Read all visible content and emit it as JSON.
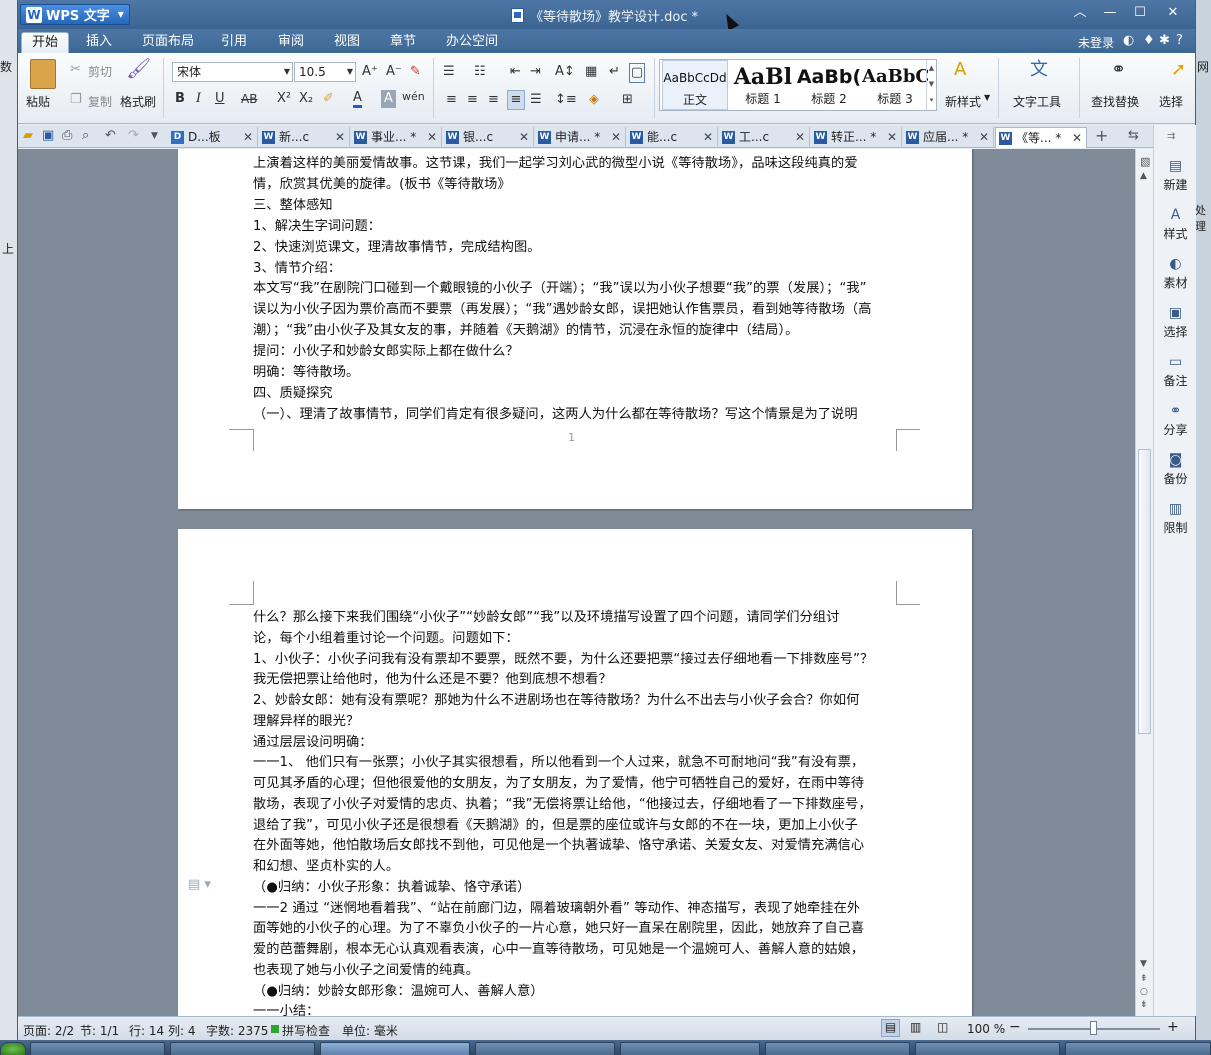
{
  "titlebar": {
    "app_name": "WPS 文字",
    "document_title": "《等待散场》教学设计.doc *",
    "minimize": "—",
    "maximize": "☐",
    "close": "✕",
    "ribbon_toggle": "︿"
  },
  "menu": {
    "tabs": [
      "开始",
      "插入",
      "页面布局",
      "引用",
      "审阅",
      "视图",
      "章节",
      "办公空间"
    ],
    "active_tab": "开始",
    "login": "未登录",
    "help": "?"
  },
  "ribbon": {
    "clipboard": {
      "paste": "粘贴",
      "cut": "剪切",
      "copy": "复制",
      "format_painter": "格式刷"
    },
    "font": {
      "font_name": "宋体",
      "font_size": "10.5"
    },
    "styles": [
      {
        "sample": "AaBbCcDd",
        "name": "正文"
      },
      {
        "sample": "AaBl",
        "name": "标题 1"
      },
      {
        "sample": "AaBb(",
        "name": "标题 2"
      },
      {
        "sample": "AaBbC",
        "name": "标题 3"
      }
    ],
    "new_style": "新样式",
    "text_tools": "文字工具",
    "find_replace": "查找替换",
    "select": "选择"
  },
  "doc_tabs": [
    {
      "label": "D...板",
      "icon": "D"
    },
    {
      "label": "新...c",
      "icon": "W"
    },
    {
      "label": "事业... *",
      "icon": "W"
    },
    {
      "label": "银...c",
      "icon": "W"
    },
    {
      "label": "申请... *",
      "icon": "W"
    },
    {
      "label": "能...c",
      "icon": "W"
    },
    {
      "label": "工...c",
      "icon": "W"
    },
    {
      "label": "转正... *",
      "icon": "W"
    },
    {
      "label": "应届... *",
      "icon": "W"
    },
    {
      "label": "《等... *",
      "icon": "W"
    }
  ],
  "page1": {
    "lines": [
      "上演着这样的美丽爱情故事。这节课，我们一起学习刘心武的微型小说《等待散场》，品味这段纯真的爱",
      "情，欣赏其优美的旋律。(板书《等待散场》",
      "三、整体感知",
      "1、解决生字词问题：",
      "2、快速浏览课文，理清故事情节，完成结构图。",
      "3、情节介绍：",
      "      本文写“我”在剧院门口碰到一个戴眼镜的小伙子（开端）；“我”误以为小伙子想要“我”的票（发展）；“我”",
      "误以为小伙子因为票价高而不要票（再发展）；“我”遇妙龄女郎，误把她认作售票员，看到她等待散场（高",
      "潮）；“我”由小伙子及其女友的事，并随着《天鹅湖》的情节，沉浸在永恒的旋律中（结局）。",
      "提问：小伙子和妙龄女郎实际上都在做什么？",
      "明确：等待散场。",
      "四、质疑探究",
      "（一）、理清了故事情节，同学们肯定有很多疑问，这两人为什么都在等待散场？写这个情景是为了说明"
    ],
    "page_number": "1"
  },
  "page2": {
    "lines": [
      "什么？那么接下来我们围绕“小伙子”“妙龄女郎”“我”以及环境描写设置了四个问题，请同学们分组讨",
      "论，每个小组着重讨论一个问题。问题如下：",
      "1、小伙子：小伙子问我有没有票却不要票，既然不要，为什么还要把票“接过去仔细地看一下排数座号”？",
      "我无偿把票让给他时，他为什么还是不要？他到底想不想看？",
      "2、妙龄女郎：她有没有票呢？那她为什么不进剧场也在等待散场？为什么不出去与小伙子会合？你如何",
      "理解异样的眼光？",
      "通过层层设问明确：",
      "一一1、  他们只有一张票；小伙子其实很想看，所以他看到一个人过来，就急不可耐地问“我”有没有票，",
      "可见其矛盾的心理；但他很爱他的女朋友，为了女朋友，为了爱情，他宁可牺牲自己的爱好，在雨中等待",
      "散场，表现了小伙子对爱情的忠贞、执着；“我”无偿将票让给他，“他接过去，仔细地看了一下排数座号，",
      "退给了我”，可见小伙子还是很想看《天鹅湖》的，但是票的座位或许与女郎的不在一块，更加上小伙子",
      "在外面等她，他怕散场后女郎找不到他，可见他是一个执著诚挚、恪守承诺、关爱女友、对爱情充满信心",
      "和幻想、坚贞朴实的人。",
      "（●归纳：小伙子形象：执着诚挚、恪守承诺）",
      "一一2 通过 “迷惘地看着我”、“站在前廊门边，隔着玻璃朝外看” 等动作、神态描写，表现了她牵挂在外",
      "面等她的小伙子的心理。为了不辜负小伙子的一片心意，她只好一直呆在剧院里，因此，她放弃了自己喜",
      "爱的芭蕾舞剧，根本无心认真观看表演，心中一直等待散场，可见她是一个温婉可人、善解人意的姑娘，",
      "也表现了她与小伙子之间爱情的纯真。",
      "（●归纳：妙龄女郎形象：温婉可人、善解人意）",
      "一一小结："
    ]
  },
  "task_pane": [
    "新建",
    "样式",
    "素材",
    "选择",
    "备注",
    "分享",
    "备份",
    "限制"
  ],
  "status": {
    "page": "页面: 2/2",
    "section": "节: 1/1",
    "row": "行: 14",
    "col": "列: 4",
    "words": "字数: 2375",
    "spell": "拼写检查",
    "unit": "单位: 毫米",
    "zoom": "100 %",
    "zoom_level": 0.5
  },
  "desktop": {
    "left_text": "数",
    "left_text2": "上",
    "right_text": "网",
    "right_text2": "处理"
  },
  "colors": {
    "titlebar": "#3b6491",
    "accent": "#2467bd",
    "page": "#ffffff",
    "doc_bg": "#7f8b99"
  }
}
